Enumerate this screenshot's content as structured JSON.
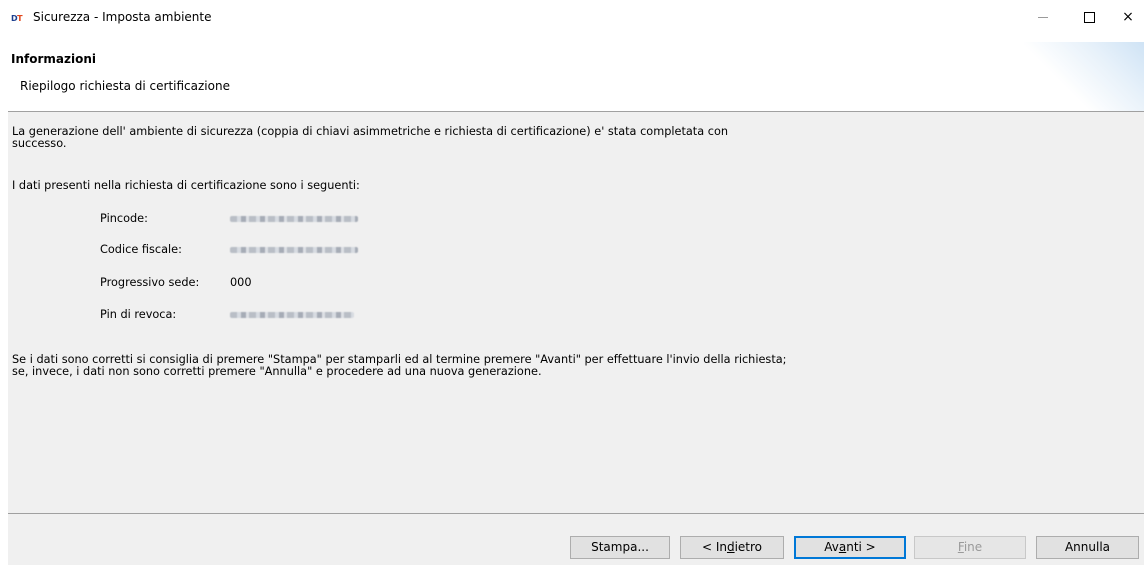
{
  "window": {
    "title": "Sicurezza - Imposta ambiente",
    "app_icon": {
      "left": "D",
      "right": "T"
    },
    "controls": {
      "minimize": "minimize-icon",
      "maximize": "maximize-icon",
      "close": "×"
    }
  },
  "header": {
    "title": "Informazioni",
    "subtitle": "Riepilogo richiesta di certificazione"
  },
  "content": {
    "intro_line1": "La generazione  dell' ambiente  di sicurezza (coppia di chiavi asimmetriche e richiesta di certificazione) e' stata completata con",
    "intro_line2": "successo.",
    "data_intro": "I dati presenti nella richiesta di certificazione sono i seguenti:",
    "fields": [
      {
        "label": "Pincode:"
      },
      {
        "label": "Codice fiscale:"
      },
      {
        "label": "Progressivo sede:",
        "value": "000"
      },
      {
        "label": "Pin di revoca:"
      }
    ],
    "note_line1": "Se i dati sono corretti si consiglia di premere \"Stampa\" per stamparli ed al termine premere \"Avanti\" per effettuare l'invio della richiesta;",
    "note_line2": "se, invece, i dati non sono corretti premere \"Annulla\" e procedere ad una nuova generazione."
  },
  "buttons": {
    "stampa": "Stampa...",
    "indietro": {
      "pre": "< In",
      "ul": "d",
      "post": "ietro"
    },
    "avanti": {
      "pre": "Av",
      "ul": "a",
      "post": "nti >"
    },
    "fine": {
      "pre": "",
      "ul": "F",
      "post": "ine"
    },
    "annulla": "Annulla"
  },
  "colors": {
    "accent": "#0078d7",
    "panel": "#f0f0f0"
  }
}
